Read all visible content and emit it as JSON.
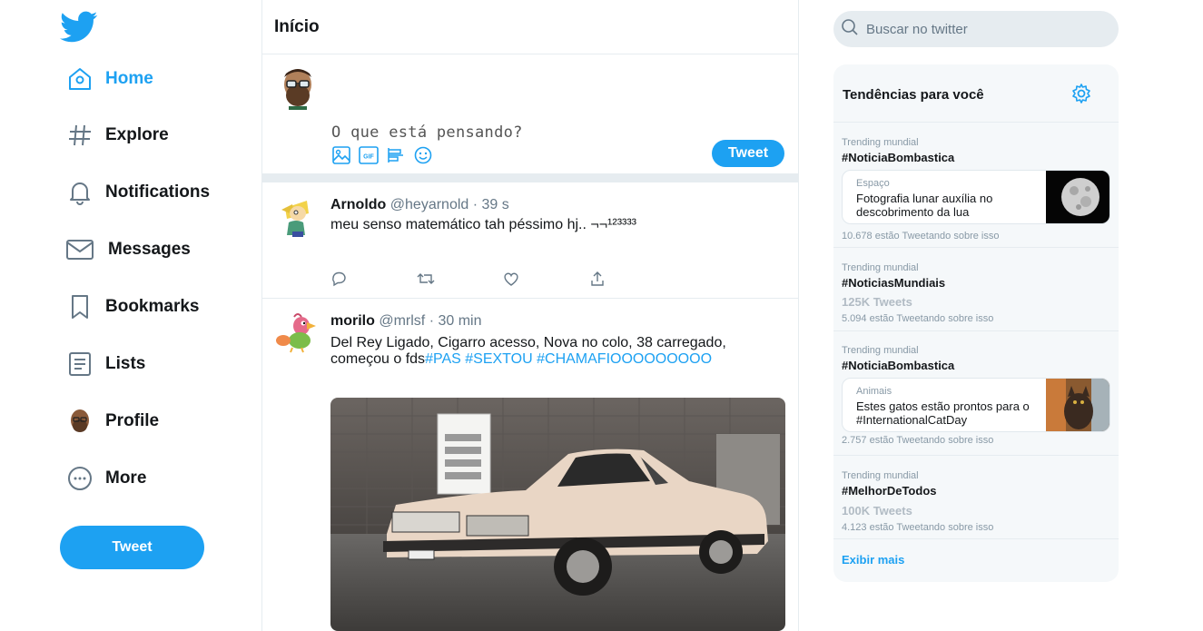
{
  "nav": {
    "items": [
      {
        "label": "Home",
        "icon": "home-icon"
      },
      {
        "label": "Explore",
        "icon": "hashtag-icon"
      },
      {
        "label": "Notifications",
        "icon": "bell-icon"
      },
      {
        "label": "Messages",
        "icon": "envelope-icon"
      },
      {
        "label": "Bookmarks",
        "icon": "bookmark-icon"
      },
      {
        "label": "Lists",
        "icon": "list-icon"
      },
      {
        "label": "Profile",
        "icon": "avatar-icon"
      },
      {
        "label": "More",
        "icon": "more-icon"
      }
    ],
    "tweet_button": "Tweet"
  },
  "main": {
    "title": "Início",
    "composer": {
      "placeholder": "O que está pensando?",
      "tweet_button": "Tweet",
      "tools": [
        "image-icon",
        "gif-icon",
        "poll-icon",
        "emoji-icon"
      ]
    },
    "tweets": [
      {
        "name": "Arnoldo",
        "handle": "@heyarnold",
        "time": "39 s",
        "text": "meu senso matemático tah péssimo hj.. ¬¬¹²³³³³"
      },
      {
        "name": "morilo",
        "handle": "@mrlsf",
        "time": "30 min",
        "text_plain": "Del Rey Ligado, Cigarro acesso, Nova no colo, 38 carregado, começou o fds",
        "hashtags": [
          "#PAS",
          "#SEXTOU",
          "#CHAMAFIOOOOOOOOO"
        ]
      }
    ]
  },
  "search": {
    "placeholder": "Buscar no twitter"
  },
  "trends": {
    "title": "Tendências para você",
    "items": [
      {
        "context": "Trending mundial",
        "name": "#NoticiaBombastica",
        "card": {
          "category": "Espaço",
          "text": "Fotografia lunar auxília no descobrimento da lua"
        },
        "sub": "10.678 estão Tweetando sobre isso"
      },
      {
        "context": "Trending mundial",
        "name": "#NoticiasMundiais",
        "count": "125K Tweets",
        "sub": "5.094 estão Tweetando sobre isso"
      },
      {
        "context": "Trending mundial",
        "name": "#NoticiaBombastica",
        "card": {
          "category": "Animais",
          "text": "Estes gatos estão prontos para o #InternationalCatDay"
        },
        "sub": "2.757 estão Tweetando sobre isso"
      },
      {
        "context": "Trending mundial",
        "name": "#MelhorDeTodos",
        "count": "100K Tweets",
        "sub": "4.123 estão Tweetando sobre isso"
      }
    ],
    "show_more": "Exibir mais"
  },
  "colors": {
    "accent": "#1da1f2",
    "text": "#14171a",
    "muted": "#657786",
    "border": "#e6ecf0",
    "panel": "#f5f8fa"
  }
}
